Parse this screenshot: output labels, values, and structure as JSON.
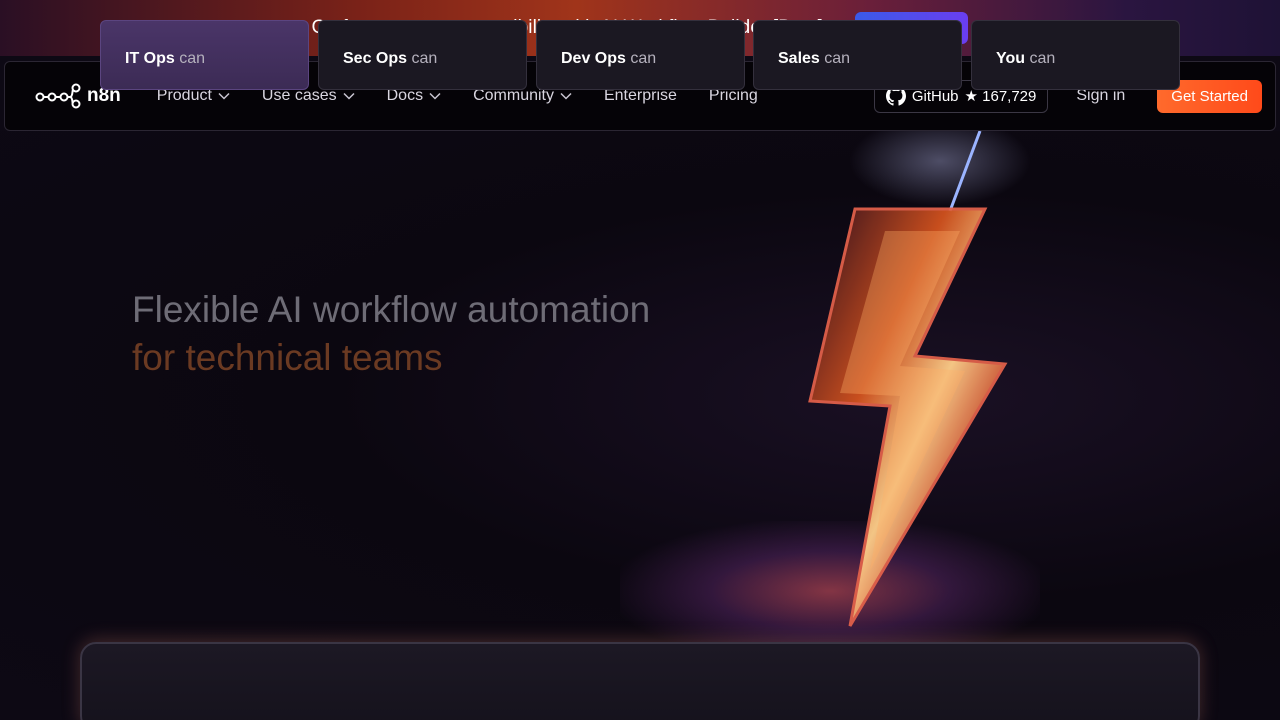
{
  "banner": {
    "text": "Go from prompt to possibility with AI Workflow Builder [Beta]",
    "button_label": "Learn how"
  },
  "nav": {
    "logo_text": "n8n",
    "items": [
      {
        "label": "Product",
        "has_dropdown": true
      },
      {
        "label": "Use cases",
        "has_dropdown": true
      },
      {
        "label": "Docs",
        "has_dropdown": true
      },
      {
        "label": "Community",
        "has_dropdown": true
      },
      {
        "label": "Enterprise",
        "has_dropdown": false
      },
      {
        "label": "Pricing",
        "has_dropdown": false
      }
    ],
    "github_label": "GitHub",
    "github_stars": "★ 167,729",
    "signin_label": "Sign in",
    "get_started_label": "Get Started"
  },
  "hero": {
    "title_line1": "Flexible AI workflow automation",
    "title_line2": "for technical teams"
  },
  "tabs": [
    {
      "team": "IT Ops",
      "suffix": "can",
      "active": true
    },
    {
      "team": "Sec Ops",
      "suffix": "can",
      "active": false
    },
    {
      "team": "Dev Ops",
      "suffix": "can",
      "active": false
    },
    {
      "team": "Sales",
      "suffix": "can",
      "active": false
    },
    {
      "team": "You",
      "suffix": "can",
      "active": false
    }
  ],
  "colors": {
    "accent_orange": "#ff5a22",
    "banner_button": "#4b4ceb",
    "active_tab": "#45325f"
  }
}
